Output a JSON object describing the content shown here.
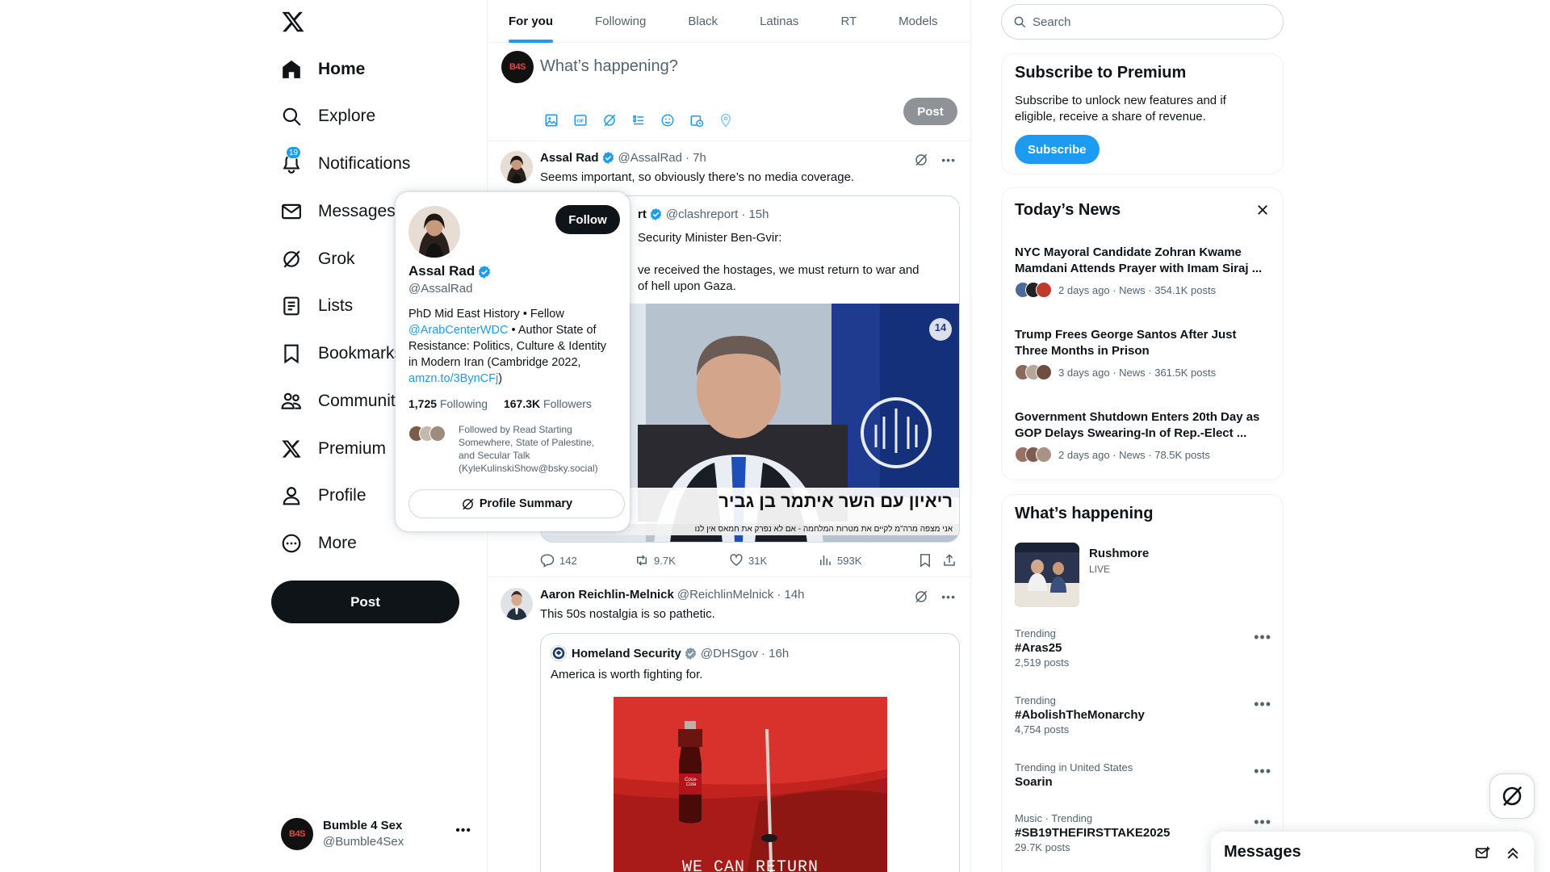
{
  "nav": {
    "items": [
      {
        "label": "Home",
        "icon": "home-icon"
      },
      {
        "label": "Explore",
        "icon": "search-icon"
      },
      {
        "label": "Notifications",
        "icon": "bell-icon",
        "badge": "19"
      },
      {
        "label": "Messages",
        "icon": "envelope-icon"
      },
      {
        "label": "Grok",
        "icon": "grok-icon"
      },
      {
        "label": "Lists",
        "icon": "list-icon"
      },
      {
        "label": "Bookmarks",
        "icon": "bookmark-icon"
      },
      {
        "label": "Communities",
        "icon": "people-icon"
      },
      {
        "label": "Premium",
        "icon": "x-logo-icon"
      },
      {
        "label": "Profile",
        "icon": "person-icon"
      },
      {
        "label": "More",
        "icon": "more-circle-icon"
      }
    ],
    "post_label": "Post",
    "account": {
      "avatar_text": "B4S",
      "name": "Bumble 4 Sex",
      "handle": "@Bumble4Sex"
    }
  },
  "tabs": [
    "For you",
    "Following",
    "Black",
    "Latinas",
    "RT",
    "Models"
  ],
  "composer": {
    "placeholder": "What’s happening?",
    "post_label": "Post"
  },
  "tweets": [
    {
      "name": "Assal Rad",
      "handle": "@AssalRad",
      "time": "· 7h",
      "text": "Seems important, so obviously there’s no media coverage.",
      "quote": {
        "name_partial": "rt",
        "handle": "@clashreport",
        "time": "· 15h",
        "line1": "Security Minister Ben-Gvir:",
        "line2": "ve received the hostages, we must return to war and",
        "line3": "of hell upon Gaza.",
        "channel_badge": "14",
        "caption": "ריאיון עם השר איתמר בן גביר",
        "subcaption": "אני מצפה מרה\"מ לקיים את מטרות המלחמה - אם לא נפרק את חמאס אין לנו"
      },
      "stats": {
        "replies": "142",
        "reposts": "9.7K",
        "likes": "31K",
        "views": "593K"
      }
    },
    {
      "name": "Aaron Reichlin-Melnick",
      "handle": "@ReichlinMelnick",
      "time": "· 14h",
      "text": "This 50s nostalgia is so pathetic.",
      "quote": {
        "name": "Homeland Security",
        "handle": "@DHSgov",
        "time": "· 16h",
        "text": "America is worth fighting for.",
        "image_caption": "WE CAN RETURN",
        "bottle_label": "Coca-Cola"
      }
    }
  ],
  "hovercard": {
    "follow_label": "Follow",
    "name": "Assal Rad",
    "handle": "@AssalRad",
    "bio_1": "PhD Mid East History • Fellow",
    "bio_link": "@ArabCenterWDC",
    "bio_2": " • Author State of",
    "bio_3": "Resistance: Politics, Culture & Identity",
    "bio_4": "in Modern Iran (Cambridge 2022,",
    "bio_url": "amzn.to/3BynCFj",
    "bio_url_close": ")",
    "following_count": "1,725",
    "following_label": "Following",
    "followers_count": "167.3K",
    "followers_label": "Followers",
    "followed_by_1": "Followed by Read Starting",
    "followed_by_2": "Somewhere, State of Palestine,",
    "followed_by_3": "and Secular Talk",
    "followed_by_4": "(KyleKulinskiShow@bsky.social)",
    "summary_label": "Profile Summary"
  },
  "right": {
    "search_placeholder": "Search",
    "premium": {
      "title": "Subscribe to Premium",
      "line1": "Subscribe to unlock new features and if",
      "line2": "eligible, receive a share of revenue.",
      "button": "Subscribe"
    },
    "news": {
      "title": "Today’s News",
      "items": [
        {
          "l1": "NYC Mayoral Candidate Zohran Kwame",
          "l2": "Mamdani Attends Prayer with Imam Siraj ...",
          "meta": "2 days ago · News · 354.1K posts"
        },
        {
          "l1": "Trump Frees George Santos After Just",
          "l2": "Three Months in Prison",
          "meta": "3 days ago · News · 361.5K posts"
        },
        {
          "l1": "Government Shutdown Enters 20th Day as",
          "l2": "GOP Delays Swearing-In of Rep.-Elect ...",
          "meta": "2 days ago · News · 78.5K posts"
        }
      ]
    },
    "happening": {
      "title": "What’s happening",
      "live": {
        "name": "Rushmore",
        "status": "LIVE"
      },
      "trends": [
        {
          "context": "Trending",
          "name": "#Aras25",
          "posts": "2,519 posts"
        },
        {
          "context": "Trending",
          "name": "#AbolishTheMonarchy",
          "posts": "4,754 posts"
        },
        {
          "context": "Trending in United States",
          "name": "Soarin",
          "posts": ""
        },
        {
          "context": "Music · Trending",
          "name": "#SB19THEFIRSTTAKE2025",
          "posts": "29.7K posts"
        }
      ]
    },
    "messages_title": "Messages"
  },
  "colors": {
    "accent": "#1d9bf0",
    "text": "#0f1419",
    "muted": "#536471",
    "border": "#eff3f4"
  }
}
